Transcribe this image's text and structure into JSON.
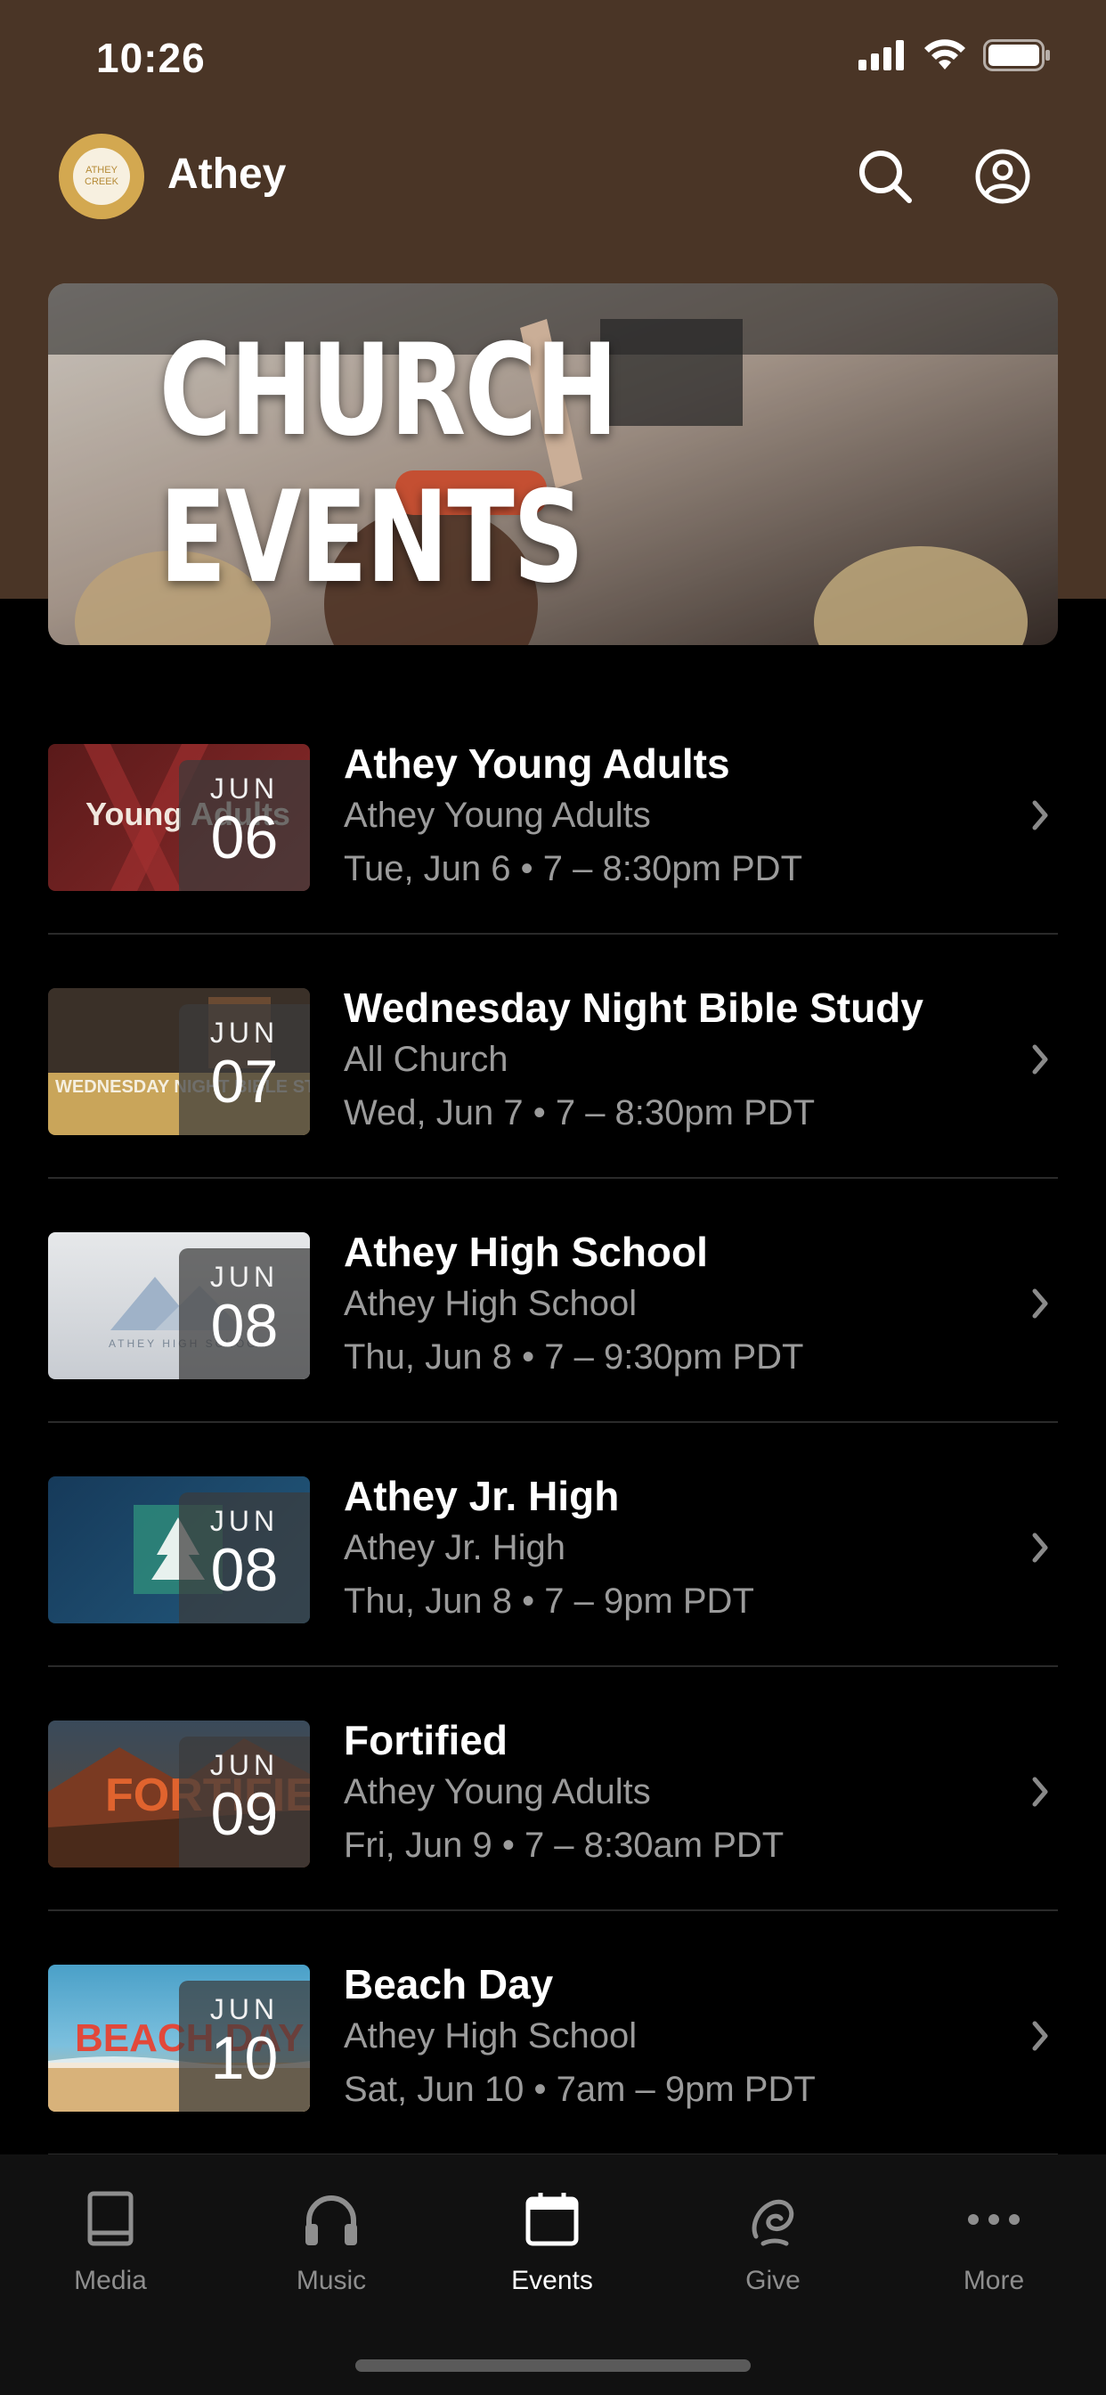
{
  "status_bar": {
    "time": "10:26"
  },
  "header": {
    "logo_text": "ATHEY CREEK",
    "brand": "Athey"
  },
  "banner": {
    "title": "CHURCH EVENTS"
  },
  "events": [
    {
      "title": "Athey Young Adults",
      "subtitle": "Athey Young Adults",
      "time": "Tue, Jun 6 • 7 – 8:30pm PDT",
      "month": "JUN",
      "day": "06",
      "thumb_caption": "Young Adults",
      "thumb_colors": [
        "#5a1a1a",
        "#8a2a2a"
      ]
    },
    {
      "title": "Wednesday Night Bible Study",
      "subtitle": "All Church",
      "time": "Wed, Jun 7 • 7 – 8:30pm PDT",
      "month": "JUN",
      "day": "07",
      "thumb_caption": "WEDNESDAY NIGHT BIBLE STUDY",
      "thumb_colors": [
        "#2a2a2a",
        "#c9a55a"
      ]
    },
    {
      "title": "Athey High School",
      "subtitle": "Athey High School",
      "time": "Thu, Jun 8 • 7 – 9:30pm PDT",
      "month": "JUN",
      "day": "08",
      "thumb_caption": "ATHEY HIGH SCHOOL",
      "thumb_colors": [
        "#e6e8ea",
        "#c8ccd2"
      ]
    },
    {
      "title": "Athey Jr. High",
      "subtitle": "Athey Jr. High",
      "time": "Thu, Jun 8 • 7 – 9pm PDT",
      "month": "JUN",
      "day": "08",
      "thumb_caption": "",
      "thumb_colors": [
        "#163a5a",
        "#23597d"
      ]
    },
    {
      "title": "Fortified",
      "subtitle": "Athey Young Adults",
      "time": "Fri, Jun 9 • 7 – 8:30am PDT",
      "month": "JUN",
      "day": "09",
      "thumb_caption": "FORTIFIED",
      "thumb_colors": [
        "#3a4a5a",
        "#8a4a2a"
      ]
    },
    {
      "title": "Beach Day",
      "subtitle": "Athey High School",
      "time": "Sat, Jun 10 • 7am – 9pm PDT",
      "month": "JUN",
      "day": "10",
      "thumb_caption": "BEACH DAY",
      "thumb_colors": [
        "#4aa0c8",
        "#d8b27a"
      ]
    }
  ],
  "tabs": [
    {
      "label": "Media",
      "icon": "book-icon",
      "active": false
    },
    {
      "label": "Music",
      "icon": "headphones-icon",
      "active": false
    },
    {
      "label": "Events",
      "icon": "calendar-icon",
      "active": true
    },
    {
      "label": "Give",
      "icon": "give-icon",
      "active": false
    },
    {
      "label": "More",
      "icon": "more-icon",
      "active": false
    }
  ],
  "colors": {
    "header_bg": "#4a3526",
    "accent_gold": "#d3a850",
    "background": "#000000",
    "secondary_text": "#9b9b9b"
  }
}
